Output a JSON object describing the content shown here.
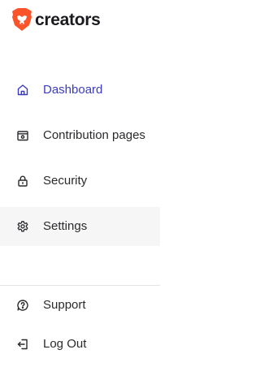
{
  "brand": {
    "name": "creators",
    "logo": "brave-lion-icon",
    "accent": "#fb542b"
  },
  "nav": {
    "dashboard": {
      "label": "Dashboard",
      "icon": "home-icon",
      "color": "#3b3bc0"
    },
    "contribution_pages": {
      "label": "Contribution pages",
      "icon": "browser-window-icon"
    },
    "security": {
      "label": "Security",
      "icon": "lock-icon"
    },
    "settings": {
      "label": "Settings",
      "icon": "gear-icon"
    }
  },
  "footer_nav": {
    "support": {
      "label": "Support",
      "icon": "help-circle-icon"
    },
    "logout": {
      "label": "Log Out",
      "icon": "logout-icon"
    }
  }
}
